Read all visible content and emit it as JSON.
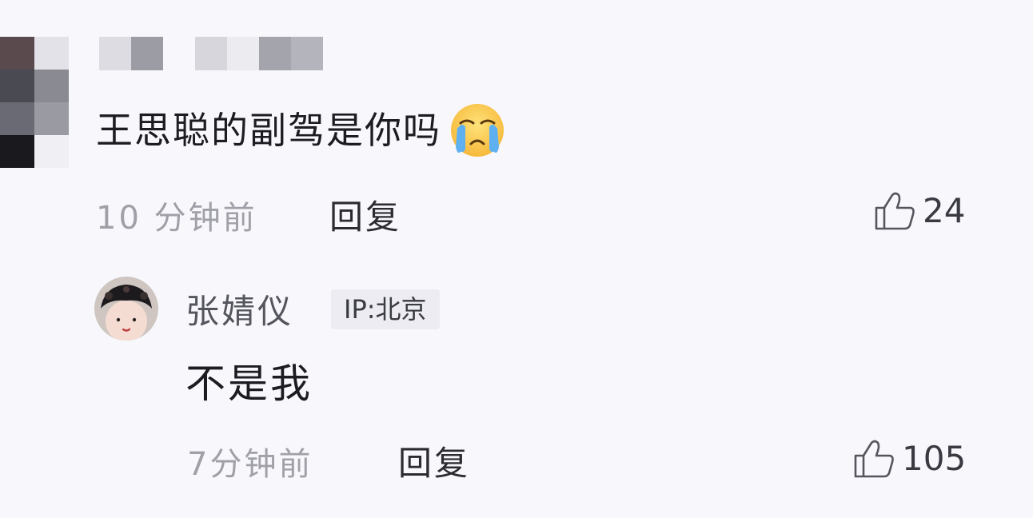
{
  "comment": {
    "text": "王思聪的副驾是你吗",
    "emoji": "loudly-crying-face",
    "time": "10 分钟前",
    "reply_label": "回复",
    "likes": "24"
  },
  "reply": {
    "username": "张婧仪",
    "ip_location": "IP:北京",
    "text": "不是我",
    "time": "7分钟前",
    "reply_label": "回复",
    "likes": "105"
  },
  "icons": {
    "like": "thumbs-up-icon",
    "emoji": "crying-face-emoji"
  },
  "colors": {
    "background": "#f8f8fc",
    "meta_text": "#a0a0a8",
    "ip_badge_bg": "#ececf2"
  }
}
